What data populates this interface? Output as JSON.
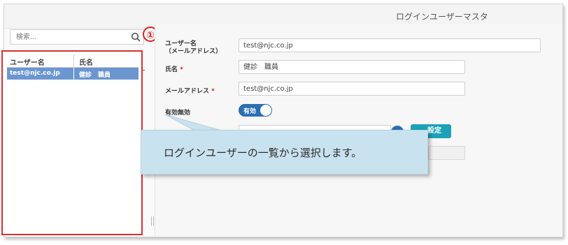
{
  "header": {
    "title": "ログインユーザーマスタ"
  },
  "search": {
    "placeholder": "検索..."
  },
  "annotation": {
    "number": "①"
  },
  "list": {
    "columns": [
      "ユーザー名",
      "氏名"
    ],
    "rows": [
      {
        "username": "test@njc.co.jp",
        "name": "健診　職員"
      }
    ]
  },
  "form": {
    "username_label_line1": "ユーザー名",
    "username_label_line2": "（メールアドレス）",
    "username_value": "test@njc.co.jp",
    "name_label": "氏名",
    "name_value": "健診　職員",
    "email_label": "メールアドレス",
    "email_value": "test@njc.co.jp",
    "required_mark": "*",
    "active_label": "有効無効",
    "active_toggle": "有効",
    "partial_button": "設定"
  },
  "callout": {
    "text": "ログインユーザーの一覧から選択します。"
  },
  "colors": {
    "accent": "#2a6fb5",
    "selected_row": "#6b96cf",
    "teal": "#1aa3b8",
    "highlight_red": "#d83030",
    "callout_bg": "#c9e2ef"
  }
}
